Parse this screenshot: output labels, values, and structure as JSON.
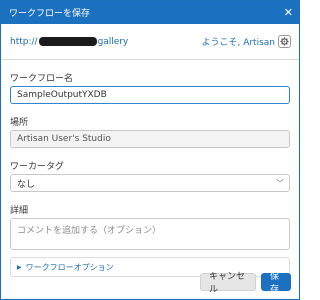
{
  "window": {
    "title": "ワークフローを保存"
  },
  "server": {
    "url_prefix": "http://",
    "url_suffix": "gallery",
    "welcome": "ようこそ, Artisan"
  },
  "fields": {
    "name_label": "ワークフロー名",
    "name_value": "SampleOutputYXDB",
    "location_label": "場所",
    "location_value": "Artisan User's Studio",
    "tag_label": "ワーカータグ",
    "tag_value": "なし",
    "details_label": "詳細",
    "details_placeholder": "コメントを追加する（オプション）"
  },
  "options": {
    "label": "ワークフローオプション"
  },
  "buttons": {
    "cancel": "キャンセル",
    "save": "保存"
  },
  "icons": {
    "close": "close-icon",
    "settings": "gear-icon",
    "dropdown": "chevron-down-icon",
    "expand": "triangle-right-icon"
  },
  "colors": {
    "accent": "#1b71bf",
    "link": "#1a6fb4"
  }
}
